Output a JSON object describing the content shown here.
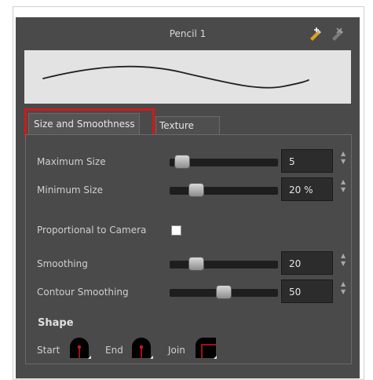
{
  "brush": {
    "title": "Pencil 1",
    "icons": [
      "add-preset-icon",
      "delete-preset-icon"
    ]
  },
  "tabs": [
    {
      "label": "Size and Smoothness",
      "active": true
    },
    {
      "label": "Texture",
      "active": false
    }
  ],
  "settings": {
    "maximum_size": {
      "label": "Maximum Size",
      "value": "5",
      "slider_fraction": 0.05
    },
    "minimum_size": {
      "label": "Minimum Size",
      "value": "20 %",
      "slider_fraction": 0.2
    },
    "proportional": {
      "label": "Proportional to Camera",
      "checked": false
    },
    "smoothing": {
      "label": "Smoothing",
      "value": "20",
      "slider_fraction": 0.2
    },
    "contour_smoothing": {
      "label": "Contour Smoothing",
      "value": "50",
      "slider_fraction": 0.5
    }
  },
  "shape": {
    "title": "Shape",
    "start_label": "Start",
    "end_label": "End",
    "join_label": "Join"
  },
  "colors": {
    "panel": "#4a4a4a",
    "highlight": "#d41818",
    "preview_bg": "#e3e3e3"
  }
}
